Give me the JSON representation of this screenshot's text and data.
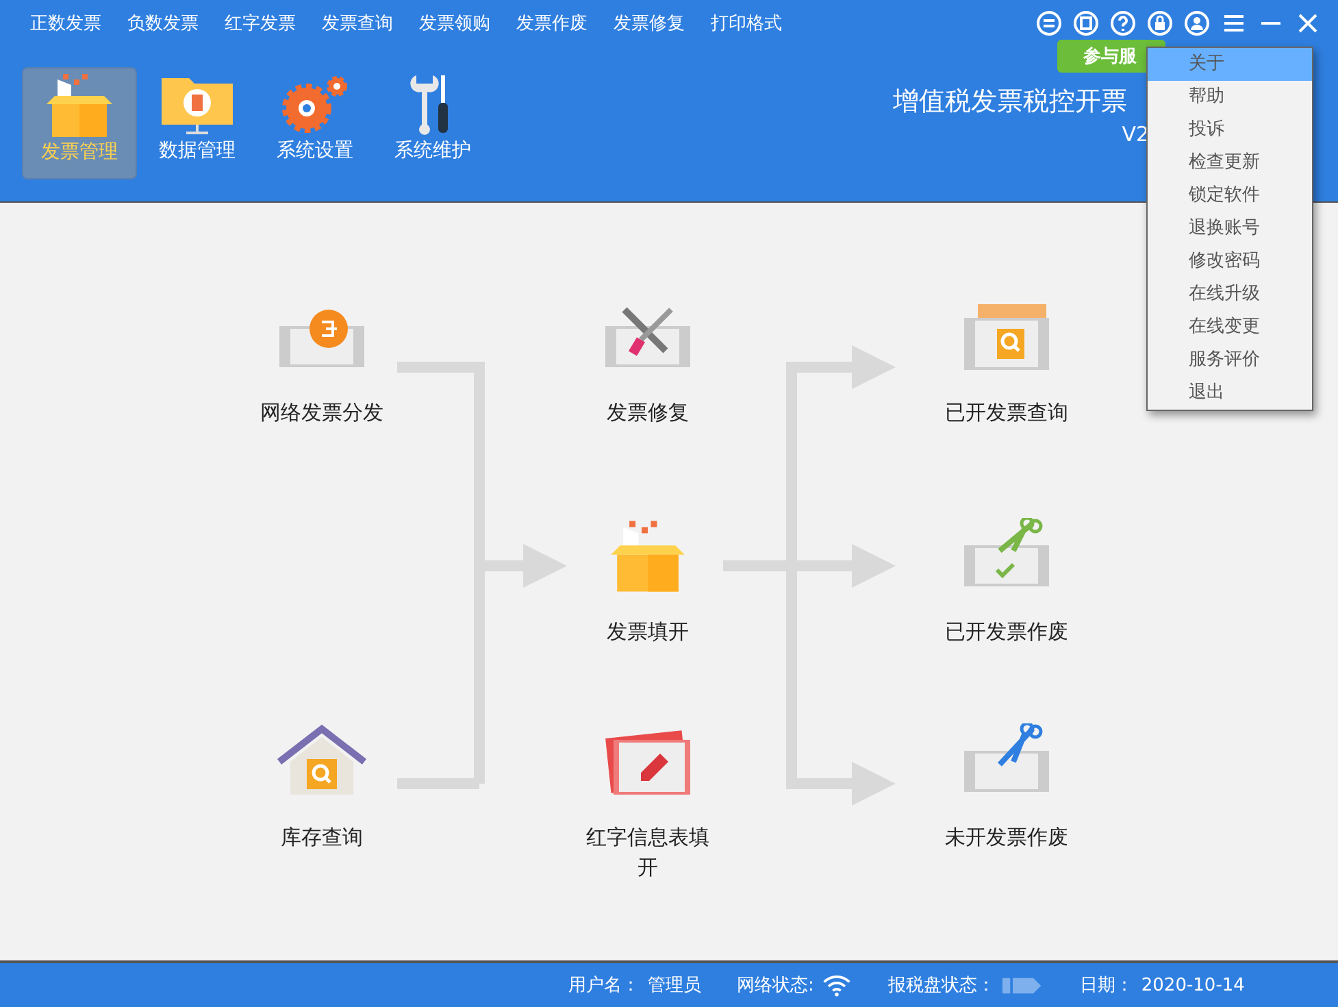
{
  "menu_bar": [
    "正数发票",
    "负数发票",
    "红字发票",
    "发票查询",
    "发票领购",
    "发票作废",
    "发票修复",
    "打印格式"
  ],
  "toolbar": [
    {
      "label": "发票管理",
      "kind": "box",
      "selected": true
    },
    {
      "label": "数据管理",
      "kind": "folder",
      "selected": false
    },
    {
      "label": "系统设置",
      "kind": "gear",
      "selected": false
    },
    {
      "label": "系统维护",
      "kind": "tools",
      "selected": false
    }
  ],
  "header": {
    "title": "增值税发票税控开票",
    "version": "V2",
    "badge": "参与服"
  },
  "dropdown": [
    {
      "label": "关于",
      "selected": true
    },
    {
      "label": "帮助",
      "selected": false
    },
    {
      "label": "投诉",
      "selected": false
    },
    {
      "label": "检查更新",
      "selected": false
    },
    {
      "label": "锁定软件",
      "selected": false
    },
    {
      "label": "退换账号",
      "selected": false
    },
    {
      "label": "修改密码",
      "selected": false
    },
    {
      "label": "在线升级",
      "selected": false
    },
    {
      "label": "在线变更",
      "selected": false
    },
    {
      "label": "服务评价",
      "selected": false
    },
    {
      "label": "退出",
      "selected": false
    }
  ],
  "flow": [
    {
      "label": "网络发票分发",
      "kind": "network"
    },
    {
      "label": "库存查询",
      "kind": "house"
    },
    {
      "label": "发票修复",
      "kind": "repair"
    },
    {
      "label": "发票填开",
      "kind": "box"
    },
    {
      "label": "红字信息表填开",
      "kind": "red"
    },
    {
      "label": "已开发票查询",
      "kind": "search"
    },
    {
      "label": "已开发票作废",
      "kind": "cut-green"
    },
    {
      "label": "未开发票作废",
      "kind": "cut-blue"
    }
  ],
  "status_bar": {
    "user_label": "用户名：",
    "user": "管理员",
    "network_label": "网络状态:",
    "disk_label": "报税盘状态：",
    "date_label": "日期：",
    "date": "2020-10-14"
  }
}
